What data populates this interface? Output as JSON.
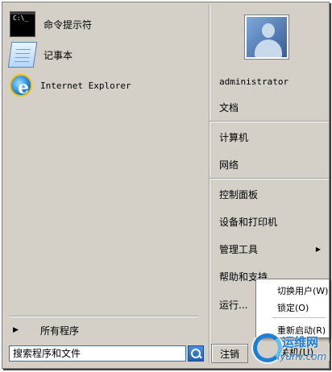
{
  "programs": [
    {
      "label": "命令提示符",
      "icon": "command-prompt-icon",
      "icon_text": "C:\\_"
    },
    {
      "label": "记事本",
      "icon": "notepad-icon"
    },
    {
      "label": "Internet Explorer",
      "icon": "internet-explorer-icon",
      "icon_text": "e"
    }
  ],
  "all_programs": {
    "label": "所有程序",
    "arrow": "▶"
  },
  "search": {
    "value": "搜索程序和文件"
  },
  "user": {
    "name": "administrator"
  },
  "right_items": {
    "documents": "文档",
    "computer": "计算机",
    "network": "网络",
    "control_panel": "控制面板",
    "devices_printers": "设备和打印机",
    "admin_tools": "管理工具",
    "admin_tools_arrow": "▶",
    "help": "帮助和支持",
    "run": "运行..."
  },
  "logout_label": "注销",
  "shutdown_label": "关机(U)",
  "submenu": {
    "switch_user": "切换用户(W)",
    "lock": "锁定(O)",
    "restart": "重新启动(R)"
  },
  "watermark": {
    "text_cn": "运维网",
    "text_url": "iyunv.com"
  }
}
